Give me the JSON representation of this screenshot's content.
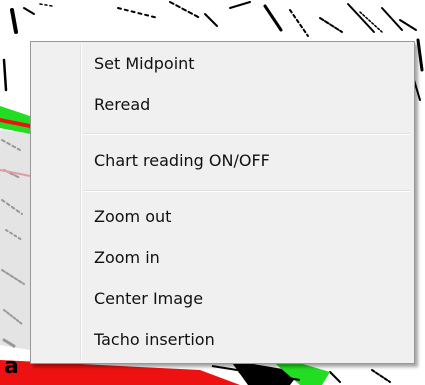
{
  "menu": {
    "groups": [
      {
        "items": [
          {
            "label": "Set Midpoint"
          },
          {
            "label": "Reread"
          }
        ]
      },
      {
        "items": [
          {
            "label": "Chart reading ON/OFF"
          }
        ]
      },
      {
        "items": [
          {
            "label": "Zoom out"
          },
          {
            "label": "Zoom in"
          },
          {
            "label": "Center Image"
          },
          {
            "label": "Tacho insertion"
          }
        ]
      }
    ]
  },
  "colors": {
    "menu_background": "#f0f0f0",
    "menu_border": "#979797",
    "backdrop_red": "#ee1111",
    "backdrop_green": "#22dd22"
  },
  "backdrop": {
    "fragment_text": "a"
  }
}
